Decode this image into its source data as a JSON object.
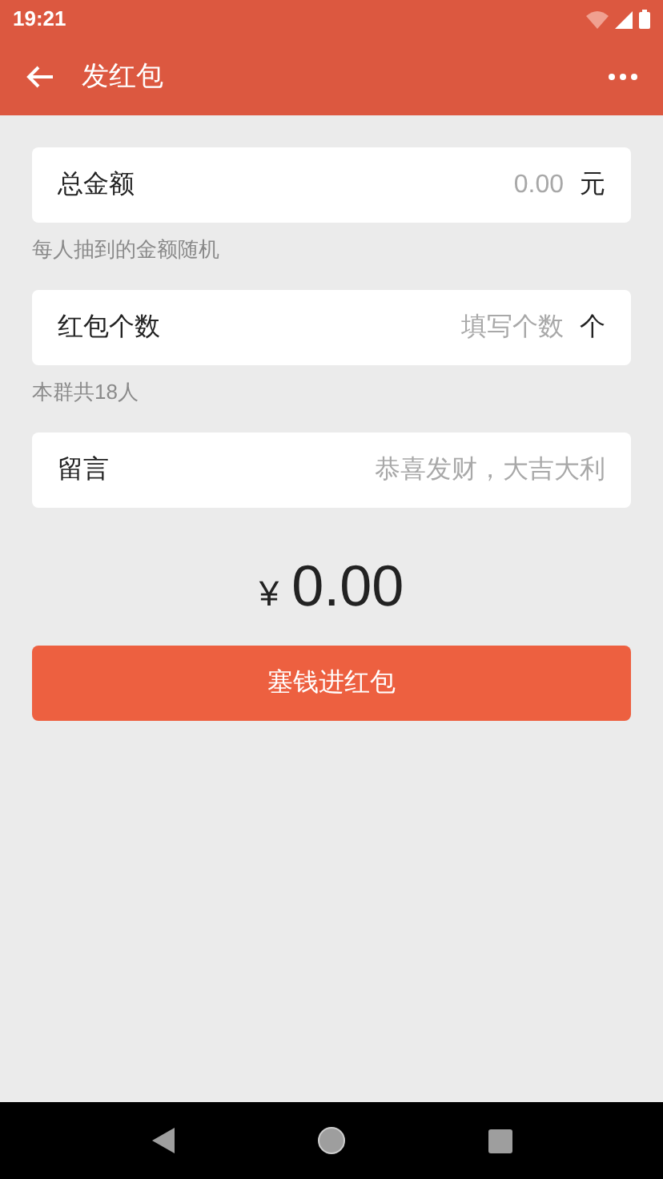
{
  "status_bar": {
    "time": "19:21"
  },
  "toolbar": {
    "title": "发红包"
  },
  "fields": [
    {
      "label": "总金额",
      "placeholder": "0.00",
      "unit": "元",
      "hint": "每人抽到的金额随机"
    },
    {
      "label": "红包个数",
      "placeholder": "填写个数",
      "unit": "个",
      "hint": "本群共18人"
    },
    {
      "label": "留言",
      "placeholder": "恭喜发财，大吉大利"
    }
  ],
  "amount": {
    "currency": "¥",
    "value": "0.00"
  },
  "submit_button": "塞钱进红包"
}
